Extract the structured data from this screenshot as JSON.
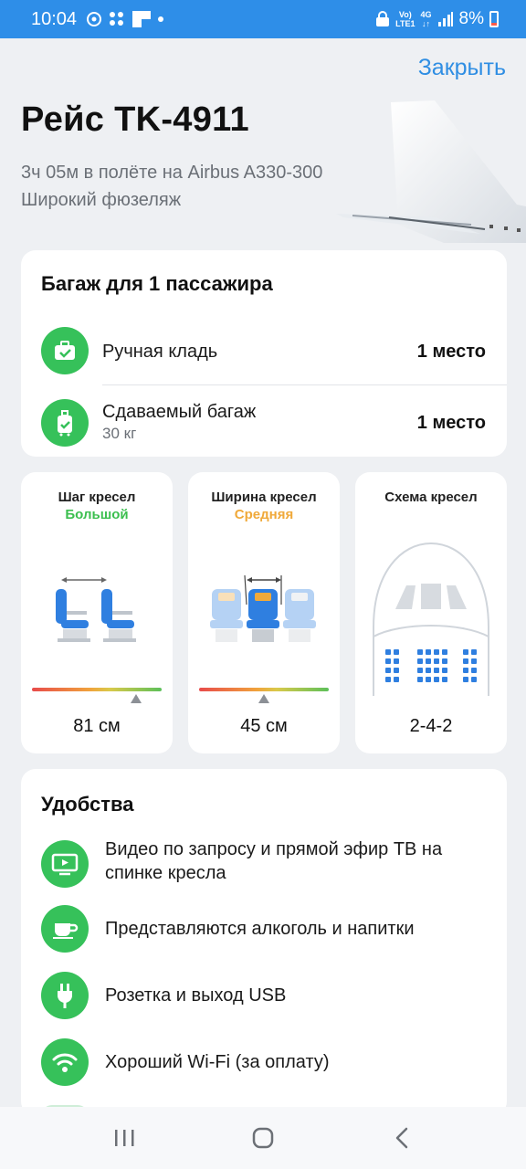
{
  "status_bar": {
    "time": "10:04",
    "network_top": "Vo)",
    "network_bottom": "LTE1",
    "network_type": "4G",
    "battery": "8%"
  },
  "header": {
    "close_label": "Закрыть",
    "title": "Рейс TK-4911",
    "subtitle_line1": "3ч 05м в полёте на Airbus A330-300",
    "subtitle_line2": "Широкий фюзеляж"
  },
  "baggage": {
    "title": "Багаж для 1 пассажира",
    "items": [
      {
        "label": "Ручная кладь",
        "sub": "",
        "value": "1 место",
        "icon": "carry-on-bag-icon"
      },
      {
        "label": "Сдаваемый багаж",
        "sub": "30 кг",
        "value": "1 место",
        "icon": "checked-luggage-icon"
      }
    ]
  },
  "seats": [
    {
      "title": "Шаг кресел",
      "grade": "Большой",
      "grade_color": "#3cbf4f",
      "value": "81 см",
      "level": 0.8
    },
    {
      "title": "Ширина кресел",
      "grade": "Средняя",
      "grade_color": "#f0a93a",
      "value": "45 см",
      "level": 0.5
    },
    {
      "title": "Схема кресел",
      "grade": "",
      "grade_color": "",
      "value": "2-4-2"
    }
  ],
  "amenities": {
    "title": "Удобства",
    "items": [
      {
        "label": "Видео по запросу и прямой эфир ТВ на спинке кресла",
        "icon": "tv-icon"
      },
      {
        "label": "Представляются алкоголь и напитки",
        "icon": "cup-icon"
      },
      {
        "label": "Розетка и выход USB",
        "icon": "power-plug-icon"
      },
      {
        "label": "Хороший Wi-Fi (за оплату)",
        "icon": "wifi-icon"
      }
    ]
  },
  "colors": {
    "accent": "#2f8ee3",
    "green": "#36c15a",
    "seat_blue": "#2f7fe0"
  }
}
